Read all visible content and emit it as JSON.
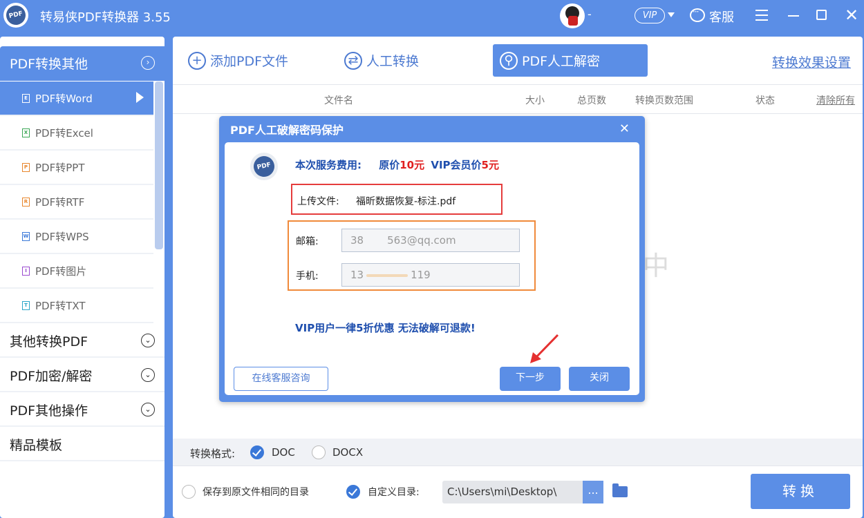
{
  "app": {
    "title": "转易侠PDF转换器 3.55",
    "logo_text": "PDF",
    "user_text": "-",
    "vip_badge": "VIP",
    "service_label": "客服"
  },
  "sidebar": {
    "header": "PDF转换其他",
    "items": [
      {
        "label": "PDF转Word",
        "badge": "E",
        "color": "#ffffff",
        "active": true
      },
      {
        "label": "PDF转Excel",
        "badge": "X",
        "color": "#3aa655"
      },
      {
        "label": "PDF转PPT",
        "badge": "P",
        "color": "#e8862c"
      },
      {
        "label": "PDF转RTF",
        "badge": "R",
        "color": "#e8862c"
      },
      {
        "label": "PDF转WPS",
        "badge": "W",
        "color": "#3a78d8"
      },
      {
        "label": "PDF转图片",
        "badge": "I",
        "color": "#9a4ad0"
      },
      {
        "label": "PDF转TXT",
        "badge": "T",
        "color": "#2aa6c8"
      }
    ],
    "categories": [
      "其他转换PDF",
      "PDF加密/解密",
      "PDF其他操作",
      "精品模板"
    ]
  },
  "toolbar": {
    "add_pdf": "添加PDF文件",
    "manual_convert": "人工转换",
    "manual_decrypt": "PDF人工解密",
    "settings_link": "转换效果设置"
  },
  "table": {
    "headers": [
      "文件名",
      "大小",
      "总页数",
      "转换页数范围",
      "状态"
    ],
    "clear_all": "清除所有",
    "bg_char": "中"
  },
  "format": {
    "label": "转换格式:",
    "options": [
      "DOC",
      "DOCX"
    ],
    "selected": "DOC"
  },
  "output": {
    "same_dir_label": "保存到原文件相同的目录",
    "custom_dir_label": "自定义目录:",
    "path": "C:\\Users\\mi\\Desktop\\",
    "browse": "...",
    "convert_button": "转换"
  },
  "dialog": {
    "title": "PDF人工破解密码保护",
    "fee_label": "本次服务费用:",
    "fee_original_prefix": "原价",
    "fee_original": "10元",
    "fee_vip_prefix": "VIP会员价",
    "fee_vip": "5元",
    "upload_label": "上传文件:",
    "upload_file": "福昕数据恢复-标注.pdf",
    "email_label": "邮箱:",
    "email_value_a": "38",
    "email_value_b": "563@qq.com",
    "phone_label": "手机:",
    "phone_value_a": "13",
    "phone_value_b": "119",
    "vip_note": "VIP用户一律5折优惠 无法破解可退款!",
    "online_button": "在线客服咨询",
    "next_button": "下一步",
    "close_button": "关闭"
  }
}
